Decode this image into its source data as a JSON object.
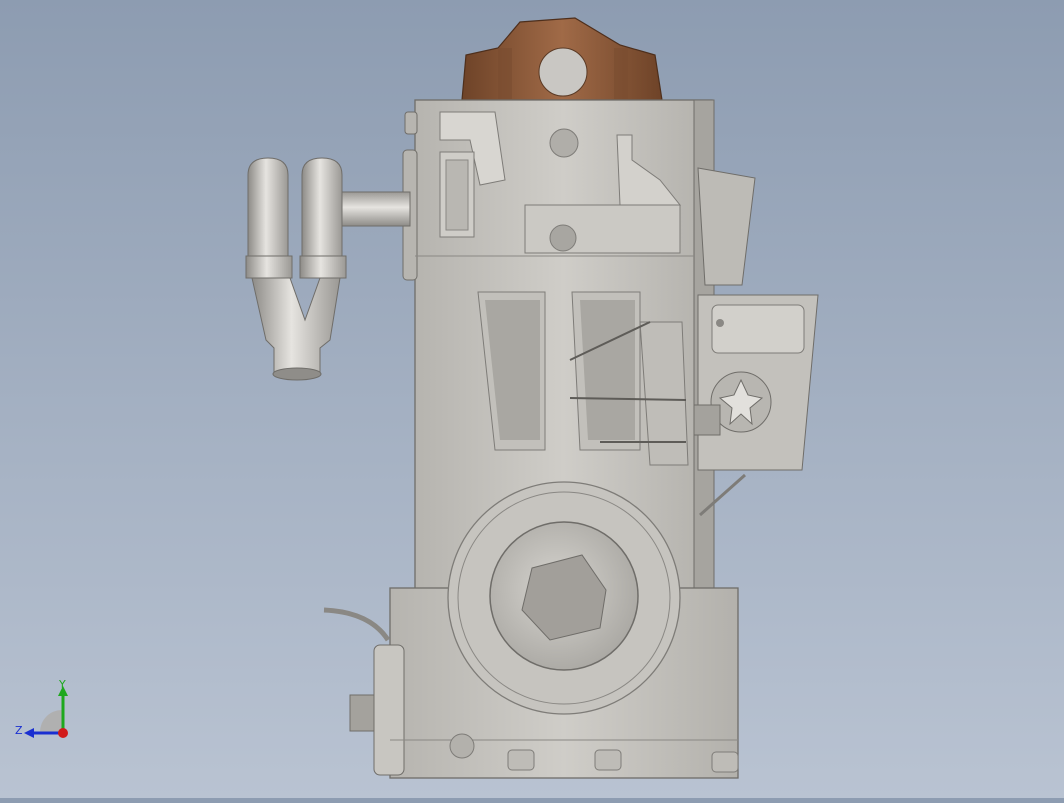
{
  "viewport": {
    "background_top": "#8d9cb1",
    "background_bottom": "#b9c3d2",
    "model": {
      "description": "engine-block-side-view",
      "body_color": "#c4c2bd",
      "shadow_color": "#8f8c86",
      "cap_color": "#8a5a3c"
    }
  },
  "triad": {
    "x_color": "#d11a1a",
    "y_color": "#1ea81e",
    "z_color": "#1a2fd1",
    "y_label": "Y",
    "z_label": "Z"
  }
}
